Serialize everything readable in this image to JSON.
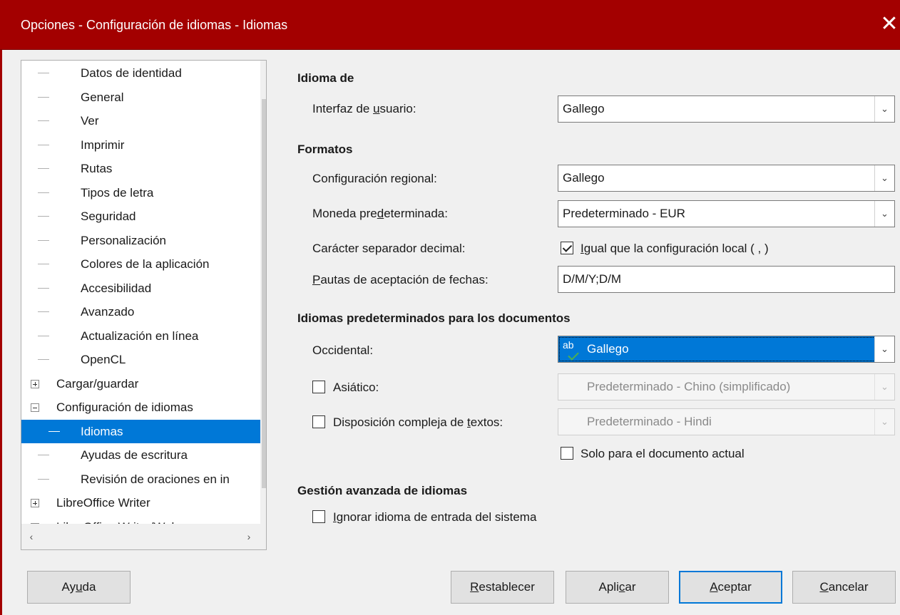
{
  "window": {
    "title": "Opciones - Configuración de idiomas - Idiomas",
    "close_glyph": "✕"
  },
  "tree": {
    "items": [
      {
        "label": "Datos de identidad",
        "level": "child"
      },
      {
        "label": "General",
        "level": "child"
      },
      {
        "label": "Ver",
        "level": "child"
      },
      {
        "label": "Imprimir",
        "level": "child"
      },
      {
        "label": "Rutas",
        "level": "child"
      },
      {
        "label": "Tipos de letra",
        "level": "child"
      },
      {
        "label": "Seguridad",
        "level": "child"
      },
      {
        "label": "Personalización",
        "level": "child"
      },
      {
        "label": "Colores de la aplicación",
        "level": "child"
      },
      {
        "label": "Accesibilidad",
        "level": "child"
      },
      {
        "label": "Avanzado",
        "level": "child"
      },
      {
        "label": "Actualización en línea",
        "level": "child"
      },
      {
        "label": "OpenCL",
        "level": "child"
      },
      {
        "label": "Cargar/guardar",
        "level": "parent",
        "expander": "plus"
      },
      {
        "label": "Configuración de idiomas",
        "level": "parent",
        "expander": "minus"
      },
      {
        "label": "Idiomas",
        "level": "child",
        "selected": true
      },
      {
        "label": "Ayudas de escritura",
        "level": "child"
      },
      {
        "label": "Revisión de oraciones en in",
        "level": "child"
      },
      {
        "label": "LibreOffice Writer",
        "level": "parent",
        "expander": "plus"
      },
      {
        "label": "LibreOffice Writer/Web",
        "level": "parent",
        "expander": "plus"
      }
    ]
  },
  "sections": {
    "idioma_de": "Idioma de",
    "formatos": "Formatos",
    "idiomas_documentos": "Idiomas predeterminados para los documentos",
    "gestion_avanzada": "Gestión avanzada de idiomas"
  },
  "ui_language": {
    "label_pre": "Interfaz de ",
    "label_u": "u",
    "label_post": "suario:",
    "value": "Gallego"
  },
  "locale": {
    "label": "Configuración regional:",
    "value": "Gallego"
  },
  "currency": {
    "label_pre": "Moneda pre",
    "label_u": "d",
    "label_post": "eterminada:",
    "value": "Predeterminado - EUR"
  },
  "decimal": {
    "label": "Carácter separador decimal:",
    "checkbox_u": "I",
    "checkbox_label": "gual que la configuración local ( , )",
    "checked": true
  },
  "date_patterns": {
    "label_u": "P",
    "label": "autas de aceptación de fechas:",
    "value": "D/M/Y;D/M"
  },
  "western": {
    "label": "Occidental:",
    "value": "Gallego",
    "icon": "ab"
  },
  "asian": {
    "label": "Asiático:",
    "value": "Predeterminado - Chino (simplificado)",
    "checked": false
  },
  "ctl": {
    "label_pre": "Disposición compleja de ",
    "label_u": "t",
    "label_post": "extos:",
    "value": "Predeterminado - Hindi",
    "checked": false
  },
  "current_doc_only": {
    "label": "Solo para el documento actual",
    "checked": false
  },
  "ignore_system": {
    "label_u": "I",
    "label": "gnorar idioma de entrada del sistema",
    "checked": false
  },
  "buttons": {
    "help_pre": "Ay",
    "help_u": "u",
    "help_post": "da",
    "reset_u": "R",
    "reset": "establecer",
    "apply_pre": "Apli",
    "apply_u": "c",
    "apply_post": "ar",
    "ok_u": "A",
    "ok": "ceptar",
    "cancel_u": "C",
    "cancel": "ancelar"
  },
  "colors": {
    "titlebar": "#a30000",
    "selection": "#0078d7"
  },
  "icons": {
    "dropdown": "chevron-down-icon",
    "scroll_up": "chevron-up-icon",
    "scroll_down": "chevron-down-icon",
    "scroll_left": "chevron-left-icon",
    "scroll_right": "chevron-right-icon"
  }
}
